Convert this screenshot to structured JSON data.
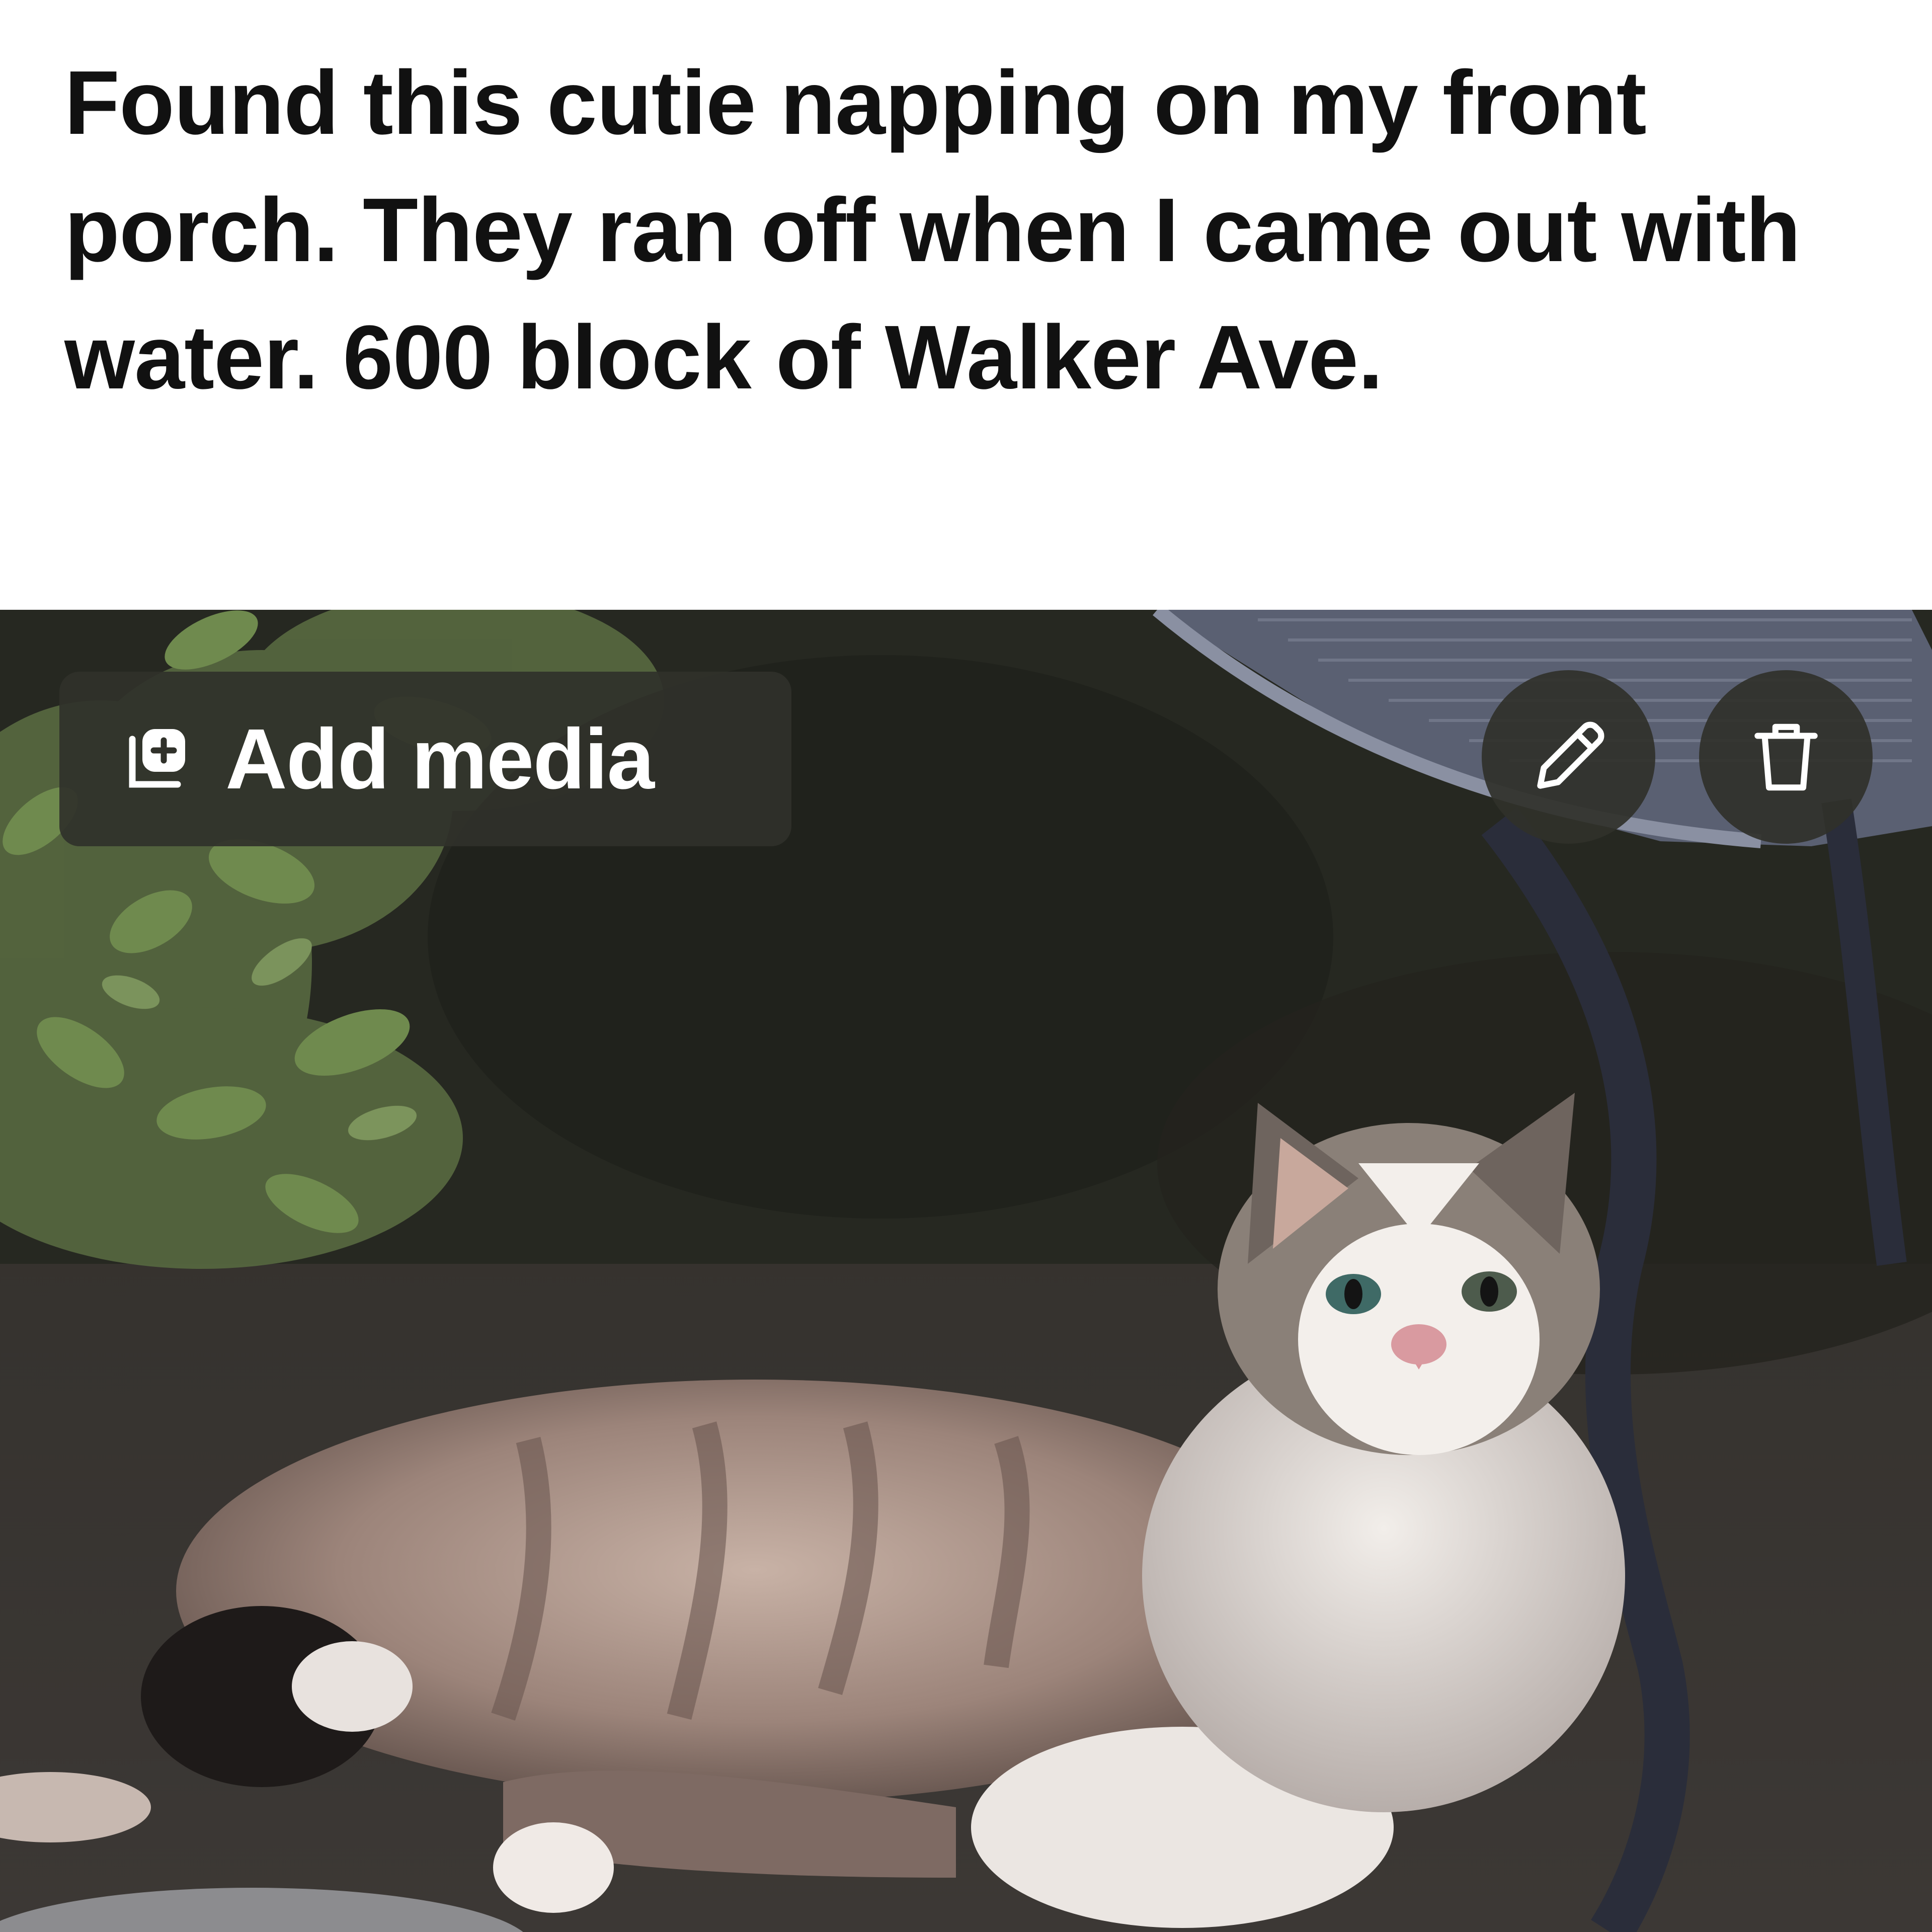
{
  "post": {
    "text": "Found this cutie napping on my front porch. They ran off when I came out with water. 600 block of Walker Ave."
  },
  "media": {
    "add_media_label": "Add media",
    "add_media_icon": "add-media-icon",
    "edit_icon": "pencil-icon",
    "delete_icon": "trash-icon"
  },
  "colors": {
    "overlay_button": "#30312a",
    "text": "#111111",
    "background": "#ffffff"
  }
}
